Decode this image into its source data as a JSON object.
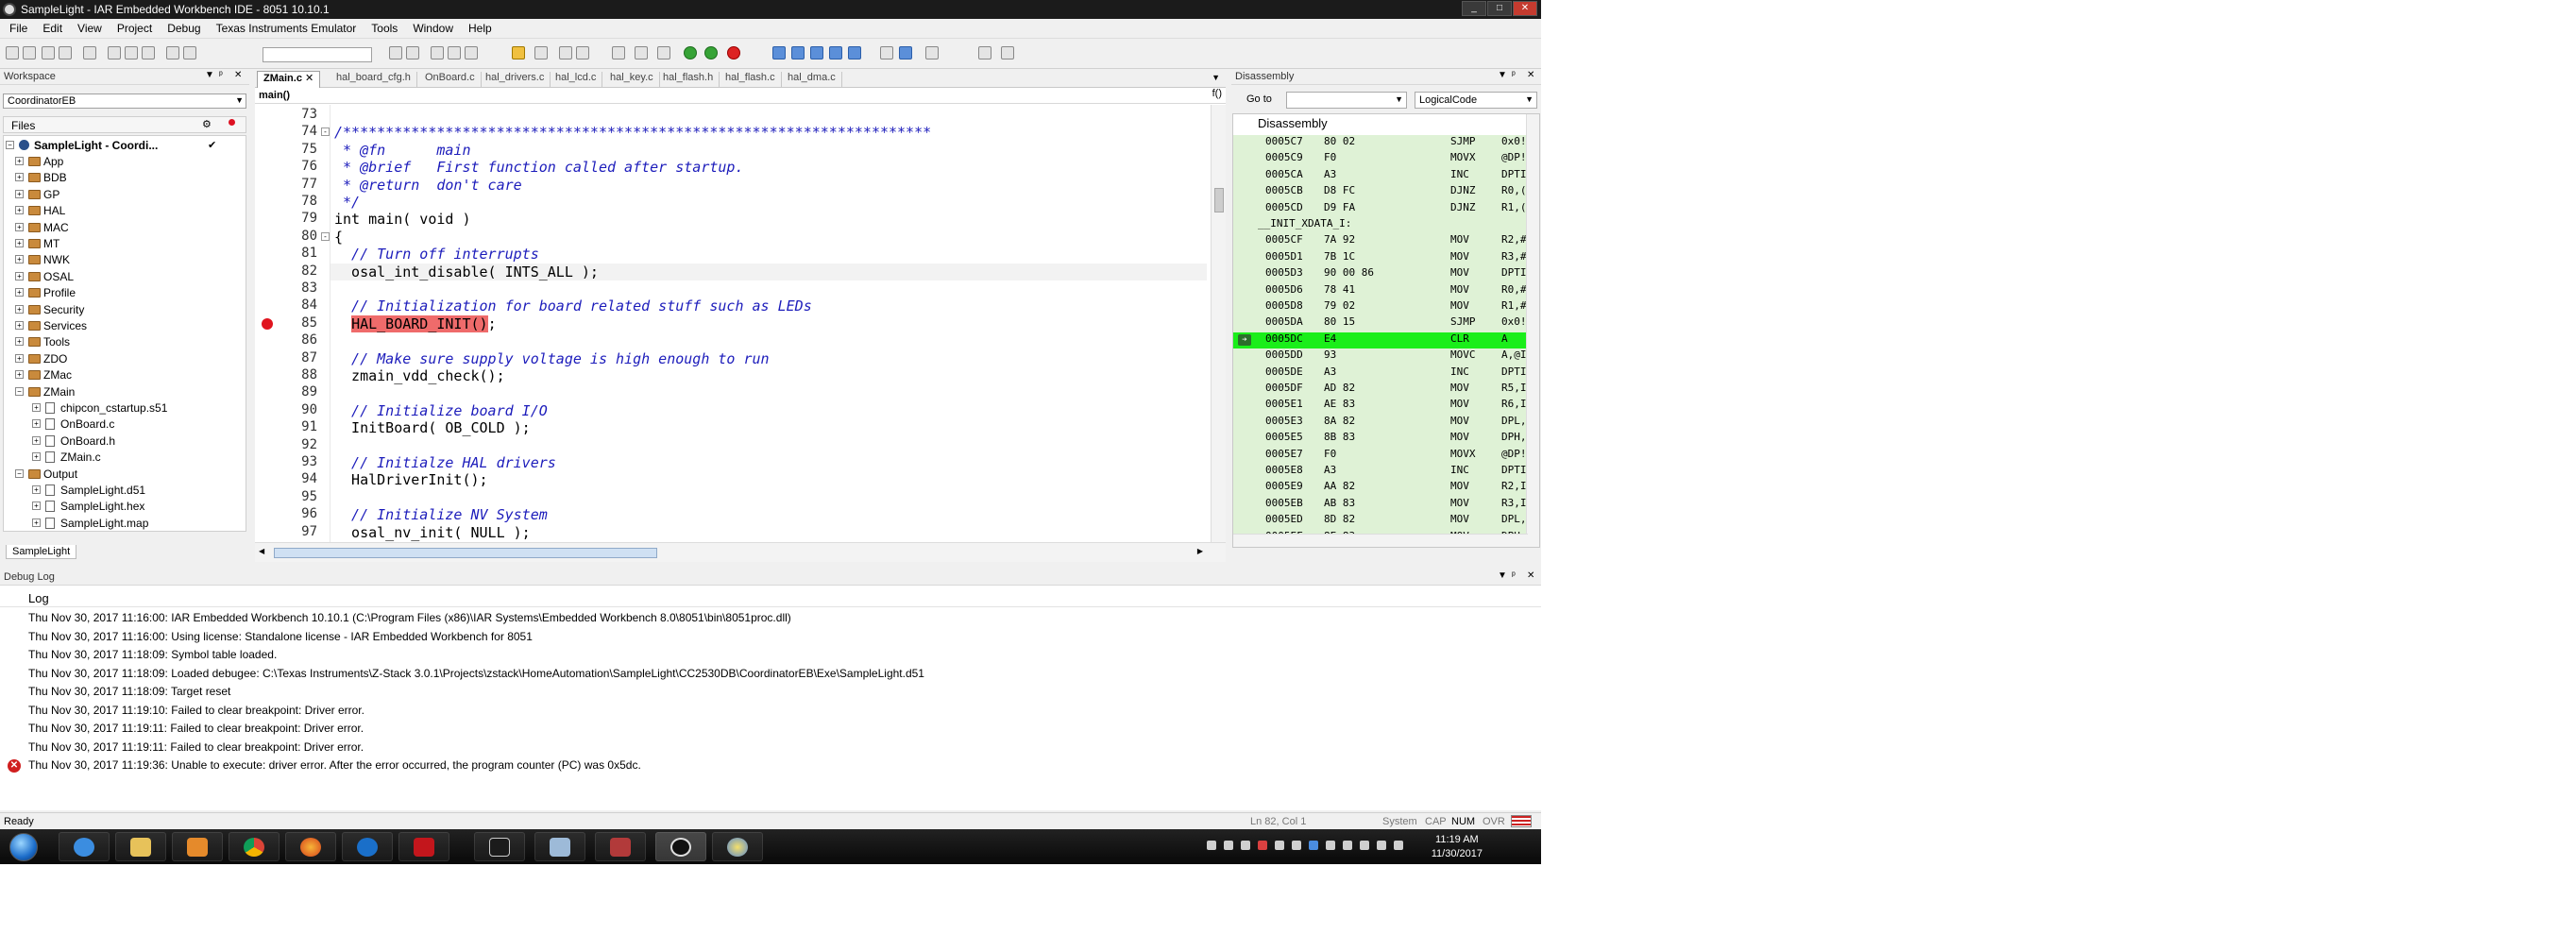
{
  "window": {
    "title": "SampleLight - IAR Embedded Workbench IDE - 8051 10.10.1"
  },
  "menu": [
    "File",
    "Edit",
    "View",
    "Project",
    "Debug",
    "Texas Instruments Emulator",
    "Tools",
    "Window",
    "Help"
  ],
  "workspace": {
    "title": "Workspace",
    "config": "CoordinatorEB",
    "files_header": "Files",
    "project": "SampleLight - Coordi...",
    "tree": [
      {
        "label": "App",
        "kind": "folder",
        "depth": 1
      },
      {
        "label": "BDB",
        "kind": "folder",
        "depth": 1
      },
      {
        "label": "GP",
        "kind": "folder",
        "depth": 1
      },
      {
        "label": "HAL",
        "kind": "folder",
        "depth": 1
      },
      {
        "label": "MAC",
        "kind": "folder",
        "depth": 1
      },
      {
        "label": "MT",
        "kind": "folder",
        "depth": 1
      },
      {
        "label": "NWK",
        "kind": "folder",
        "depth": 1
      },
      {
        "label": "OSAL",
        "kind": "folder",
        "depth": 1
      },
      {
        "label": "Profile",
        "kind": "folder",
        "depth": 1
      },
      {
        "label": "Security",
        "kind": "folder",
        "depth": 1
      },
      {
        "label": "Services",
        "kind": "folder",
        "depth": 1
      },
      {
        "label": "Tools",
        "kind": "folder",
        "depth": 1
      },
      {
        "label": "ZDO",
        "kind": "folder",
        "depth": 1
      },
      {
        "label": "ZMac",
        "kind": "folder",
        "depth": 1
      },
      {
        "label": "ZMain",
        "kind": "folder",
        "depth": 1
      },
      {
        "label": "chipcon_cstartup.s51",
        "kind": "file",
        "depth": 2
      },
      {
        "label": "OnBoard.c",
        "kind": "file",
        "depth": 2
      },
      {
        "label": "OnBoard.h",
        "kind": "file",
        "depth": 2
      },
      {
        "label": "ZMain.c",
        "kind": "file",
        "depth": 2
      },
      {
        "label": "Output",
        "kind": "folder",
        "depth": 1
      },
      {
        "label": "SampleLight.d51",
        "kind": "file",
        "depth": 2
      },
      {
        "label": "SampleLight.hex",
        "kind": "file",
        "depth": 2
      },
      {
        "label": "SampleLight.map",
        "kind": "file",
        "depth": 2
      }
    ],
    "bottom_tab": "SampleLight"
  },
  "editor": {
    "tabs": [
      "ZMain.c",
      "hal_board_cfg.h",
      "OnBoard.c",
      "hal_drivers.c",
      "hal_lcd.c",
      "hal_key.c",
      "hal_flash.h",
      "hal_flash.c",
      "hal_dma.c"
    ],
    "function": "main()",
    "fx": "f()",
    "lines": [
      {
        "n": "73",
        "t": ""
      },
      {
        "n": "74",
        "t": "/*********************************************************************",
        "c": true,
        "fold": "-"
      },
      {
        "n": "75",
        "t": " * @fn      main",
        "c": true
      },
      {
        "n": "76",
        "t": " * @brief   First function called after startup.",
        "c": true
      },
      {
        "n": "77",
        "t": " * @return  don't care",
        "c": true
      },
      {
        "n": "78",
        "t": " */",
        "c": true
      },
      {
        "n": "79",
        "t": "int main( void )"
      },
      {
        "n": "80",
        "t": "{",
        "fold": "-"
      },
      {
        "n": "81",
        "t": "  // Turn off interrupts",
        "c": true
      },
      {
        "n": "82",
        "t": "  osal_int_disable( INTS_ALL );"
      },
      {
        "n": "83",
        "t": ""
      },
      {
        "n": "84",
        "t": "  // Initialization for board related stuff such as LEDs",
        "c": true
      },
      {
        "n": "85",
        "t": "  HAL_BOARD_INIT();",
        "bp": true
      },
      {
        "n": "86",
        "t": ""
      },
      {
        "n": "87",
        "t": "  // Make sure supply voltage is high enough to run",
        "c": true
      },
      {
        "n": "88",
        "t": "  zmain_vdd_check();"
      },
      {
        "n": "89",
        "t": ""
      },
      {
        "n": "90",
        "t": "  // Initialize board I/O",
        "c": true
      },
      {
        "n": "91",
        "t": "  InitBoard( OB_COLD );"
      },
      {
        "n": "92",
        "t": ""
      },
      {
        "n": "93",
        "t": "  // Initialze HAL drivers",
        "c": true
      },
      {
        "n": "94",
        "t": "  HalDriverInit();"
      },
      {
        "n": "95",
        "t": ""
      },
      {
        "n": "96",
        "t": "  // Initialize NV System",
        "c": true
      },
      {
        "n": "97",
        "t": "  osal_nv_init( NULL );"
      }
    ]
  },
  "disassembly": {
    "title": "Disassembly",
    "goto_label": "Go to",
    "mode": "LogicalCode",
    "header": "Disassembly",
    "rows": [
      {
        "a": "0005C7",
        "c": "80 02",
        "m": "SJMP",
        "o": "0x0!"
      },
      {
        "a": "0005C9",
        "c": "F0",
        "m": "MOVX",
        "o": "@DP!"
      },
      {
        "a": "0005CA",
        "c": "A3",
        "m": "INC",
        "o": "DPTI"
      },
      {
        "a": "0005CB",
        "c": "D8 FC",
        "m": "DJNZ",
        "o": "R0,("
      },
      {
        "a": "0005CD",
        "c": "D9 FA",
        "m": "DJNZ",
        "o": "R1,("
      },
      {
        "label": "__INIT_XDATA_I:"
      },
      {
        "a": "0005CF",
        "c": "7A 92",
        "m": "MOV",
        "o": "R2,#"
      },
      {
        "a": "0005D1",
        "c": "7B 1C",
        "m": "MOV",
        "o": "R3,#"
      },
      {
        "a": "0005D3",
        "c": "90 00 86",
        "m": "MOV",
        "o": "DPTI"
      },
      {
        "a": "0005D6",
        "c": "78 41",
        "m": "MOV",
        "o": "R0,#"
      },
      {
        "a": "0005D8",
        "c": "79 02",
        "m": "MOV",
        "o": "R1,#"
      },
      {
        "a": "0005DA",
        "c": "80 15",
        "m": "SJMP",
        "o": "0x0!"
      },
      {
        "a": "0005DC",
        "c": "E4",
        "m": "CLR",
        "o": "A",
        "cur": true
      },
      {
        "a": "0005DD",
        "c": "93",
        "m": "MOVC",
        "o": "A,@I"
      },
      {
        "a": "0005DE",
        "c": "A3",
        "m": "INC",
        "o": "DPTI"
      },
      {
        "a": "0005DF",
        "c": "AD 82",
        "m": "MOV",
        "o": "R5,I"
      },
      {
        "a": "0005E1",
        "c": "AE 83",
        "m": "MOV",
        "o": "R6,I"
      },
      {
        "a": "0005E3",
        "c": "8A 82",
        "m": "MOV",
        "o": "DPL,"
      },
      {
        "a": "0005E5",
        "c": "8B 83",
        "m": "MOV",
        "o": "DPH,"
      },
      {
        "a": "0005E7",
        "c": "F0",
        "m": "MOVX",
        "o": "@DP!"
      },
      {
        "a": "0005E8",
        "c": "A3",
        "m": "INC",
        "o": "DPTI"
      },
      {
        "a": "0005E9",
        "c": "AA 82",
        "m": "MOV",
        "o": "R2,I"
      },
      {
        "a": "0005EB",
        "c": "AB 83",
        "m": "MOV",
        "o": "R3,I"
      },
      {
        "a": "0005ED",
        "c": "8D 82",
        "m": "MOV",
        "o": "DPL,"
      },
      {
        "a": "0005EF",
        "c": "8E 83",
        "m": "MOV",
        "o": "DPH,"
      }
    ]
  },
  "debug_log": {
    "title": "Debug Log",
    "column": "Log",
    "entries": [
      {
        "text": "Thu Nov 30, 2017 11:16:00: IAR Embedded Workbench 10.10.1 (C:\\Program Files (x86)\\IAR Systems\\Embedded Workbench 8.0\\8051\\bin\\8051proc.dll)"
      },
      {
        "text": "Thu Nov 30, 2017 11:16:00: Using license: Standalone license - IAR Embedded Workbench for 8051"
      },
      {
        "text": "Thu Nov 30, 2017 11:18:09: Symbol table loaded."
      },
      {
        "text": "Thu Nov 30, 2017 11:18:09: Loaded debugee: C:\\Texas Instruments\\Z-Stack 3.0.1\\Projects\\zstack\\HomeAutomation\\SampleLight\\CC2530DB\\CoordinatorEB\\Exe\\SampleLight.d51"
      },
      {
        "text": "Thu Nov 30, 2017 11:18:09: Target reset"
      },
      {
        "text": "Thu Nov 30, 2017 11:19:10: Failed to clear breakpoint: Driver error."
      },
      {
        "text": "Thu Nov 30, 2017 11:19:11: Failed to clear breakpoint: Driver error."
      },
      {
        "text": "Thu Nov 30, 2017 11:19:11: Failed to clear breakpoint: Driver error."
      },
      {
        "text": "Thu Nov 30, 2017 11:19:36: Unable to execute: driver error. After the error occurred, the program counter (PC) was 0x5dc.",
        "error": true
      }
    ]
  },
  "status": {
    "left": "Ready",
    "position": "Ln 82, Col 1",
    "system": "System",
    "caps": "CAP",
    "num": "NUM",
    "ovr": "OVR"
  },
  "taskbar": {
    "time": "11:19 AM",
    "date": "11/30/2017",
    "apps": [
      "ie-icon",
      "explorer-icon",
      "media-player-icon",
      "chrome-icon",
      "firefox-icon",
      "teamviewer-icon",
      "acrobat-icon",
      "ti-icon",
      "notepad-icon",
      "toolbox-icon",
      "iar-icon",
      "paint-icon"
    ]
  }
}
